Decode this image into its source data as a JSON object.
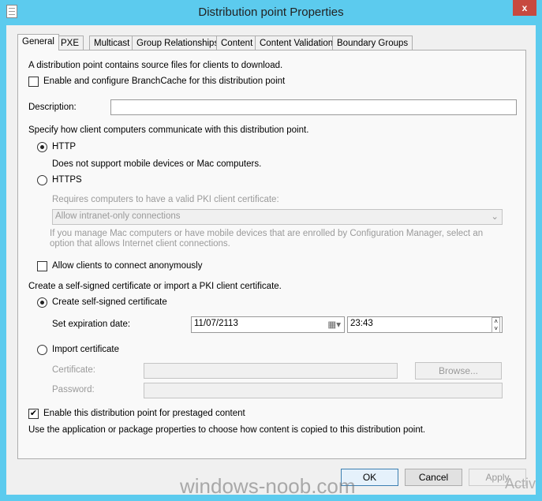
{
  "window": {
    "title": "Distribution point Properties",
    "close_label": "x"
  },
  "tabs": [
    "General",
    "PXE",
    "Multicast",
    "Group Relationships",
    "Content",
    "Content Validation",
    "Boundary Groups"
  ],
  "general": {
    "intro": "A distribution point contains source files for clients to download.",
    "branchcache_label": "Enable and configure BranchCache for this distribution point",
    "branchcache_checked": false,
    "description_label": "Description:",
    "description_value": "",
    "communicate_label": "Specify how client computers communicate with this distribution point.",
    "http_label": "HTTP",
    "http_selected": true,
    "http_note": "Does not support mobile devices or Mac computers.",
    "https_label": "HTTPS",
    "https_selected": false,
    "pki_label": "Requires computers to have a valid PKI client certificate:",
    "pki_select_value": "Allow intranet-only connections",
    "mac_note": "If you manage Mac computers or have mobile devices that are enrolled by Configuration Manager, select an option that allows Internet client connections.",
    "anonymous_label": "Allow clients to connect anonymously",
    "anonymous_checked": false,
    "cert_label": "Create a self-signed certificate or import a PKI client certificate.",
    "selfsigned_label": "Create self-signed certificate",
    "selfsigned_selected": true,
    "expiration_label": "Set expiration date:",
    "expiration_date": "11/07/2113",
    "expiration_time": "23:43",
    "import_label": "Import certificate",
    "import_selected": false,
    "certificate_label": "Certificate:",
    "certificate_value": "",
    "browse_label": "Browse...",
    "password_label": "Password:",
    "password_value": "",
    "prestaged_label": "Enable this distribution point for prestaged content",
    "prestaged_checked": true,
    "prestaged_note": "Use the application or package properties to choose how content is copied to this distribution point."
  },
  "buttons": {
    "ok": "OK",
    "cancel": "Cancel",
    "apply": "Apply"
  },
  "watermark": "windows-noob.com",
  "activate_overlay": "Activ"
}
